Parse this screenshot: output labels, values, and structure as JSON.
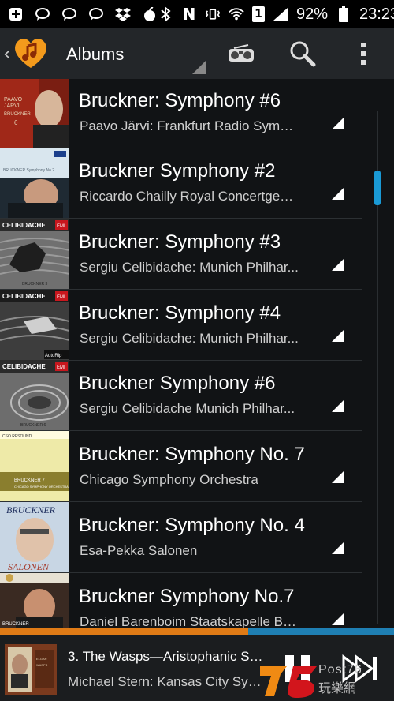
{
  "status_bar": {
    "left_icons": [
      "add-box-icon",
      "chat-bubble-icon",
      "chat-bubble-icon",
      "chat-bubble-icon",
      "dropbox-icon",
      "apple-icon"
    ],
    "right_icons": [
      "bluetooth-icon",
      "nfc-icon",
      "vibrate-icon",
      "wifi-icon",
      "sim-1-icon",
      "signal-icon"
    ],
    "sim_label": "1",
    "nfc_label": "N",
    "battery": "92%",
    "time": "23:23"
  },
  "action_bar": {
    "title": "Albums",
    "actions": [
      "radio-icon",
      "search-icon",
      "overflow-menu-icon"
    ]
  },
  "albums": [
    {
      "title": "Bruckner: Symphony #6",
      "subtitle": "Paavo Järvi: Frankfurt Radio Symph...",
      "cover": {
        "bg": "#a02818",
        "accent": "#c9b89a",
        "text": "PAAVO JÄRVI",
        "text2": "BRUCKNER 6"
      }
    },
    {
      "title": "Bruckner  Symphony #2",
      "subtitle": "Riccardo Chailly  Royal Concertgebo...",
      "cover": {
        "bg": "#d9e6ee",
        "accent": "#3a3a3a",
        "text": "",
        "text2": "DECCA"
      }
    },
    {
      "title": "Bruckner: Symphony #3",
      "subtitle": "Sergiu Celibidache: Munich Philhar...",
      "cover": {
        "bg": "#5a5a5a",
        "accent": "#2a2a2a",
        "text": "CELIBIDACHE",
        "text2": "EMI"
      }
    },
    {
      "title": "Bruckner: Symphony #4",
      "subtitle": "Sergiu Celibidache: Munich Philhar...",
      "cover": {
        "bg": "#3a3a3a",
        "accent": "#8a8a8a",
        "text": "CELIBIDACHE",
        "text2": "EMI"
      }
    },
    {
      "title": "Bruckner  Symphony #6",
      "subtitle": "Sergiu Celibidache  Munich Philhar...",
      "cover": {
        "bg": "#6d6d6d",
        "accent": "#aaaaaa",
        "text": "CELIBIDACHE",
        "text2": "EMI"
      }
    },
    {
      "title": "Bruckner: Symphony No. 7",
      "subtitle": "Chicago Symphony Orchestra",
      "cover": {
        "bg": "#e9e5a2",
        "accent": "#8a7e2e",
        "text": "CSO RESOUND",
        "text2": "BRUCKNER 7"
      }
    },
    {
      "title": "Bruckner: Symphony No. 4",
      "subtitle": "Esa-Pekka Salonen",
      "cover": {
        "bg": "#c8d6e4",
        "accent": "#a63a2a",
        "text": "BRUCKNER",
        "text2": "SALONEN"
      }
    },
    {
      "title": "Bruckner  Symphony No.7",
      "subtitle": "Daniel Barenboim  Staatskapelle Be...",
      "cover": {
        "bg": "#3a2a22",
        "accent": "#c9a24a",
        "text": "BRUCKNER",
        "text2": "DANIEL"
      }
    }
  ],
  "now_playing": {
    "title": "3. The Wasps—Aristophanic Sui...",
    "artist": "Michael Stern: Kansas City Sym...",
    "progress": 0.63
  },
  "watermark": {
    "logo_text": "76",
    "site": "Post76",
    "cjk": "玩樂網"
  },
  "colors": {
    "accent": "#1a9ad6",
    "progress": "#e07b16",
    "action_bar": "#232629",
    "list_bg": "#111315"
  }
}
